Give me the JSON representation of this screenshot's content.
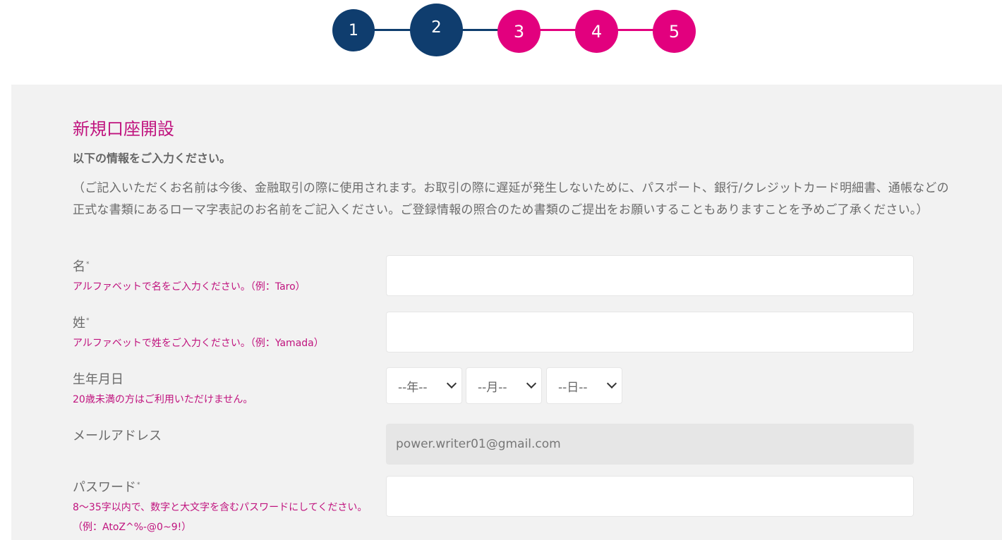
{
  "stepper": {
    "steps": [
      {
        "label": "1",
        "state": "done"
      },
      {
        "label": "2",
        "state": "current"
      },
      {
        "label": "3",
        "state": "todo"
      },
      {
        "label": "4",
        "state": "todo"
      },
      {
        "label": "5",
        "state": "todo"
      }
    ],
    "colors": {
      "done": "#0f3d6e",
      "todo": "#e2007e"
    }
  },
  "form": {
    "title": "新規口座開設",
    "subtitle": "以下の情報をご入力ください。",
    "notice": "（ご記入いただくお名前は今後、金融取引の際に使用されます。お取引の際に遅延が発生しないために、パスポート、銀行/クレジットカード明細書、通帳などの正式な書類にあるローマ字表記のお名前をご記入ください。ご登録情報の照合のため書類のご提出をお願いすることもありますことを予めご了承ください。）",
    "required_mark": "*",
    "first_name": {
      "label": "名",
      "hint": "アルファベットで名をご入力ください。（例：Taro）",
      "value": ""
    },
    "last_name": {
      "label": "姓",
      "hint": "アルファベットで姓をご入力ください。（例：Yamada）",
      "value": ""
    },
    "birthdate": {
      "label": "生年月日",
      "hint": "20歳未満の方はご利用いただけません。",
      "year": "--年--",
      "month": "--月--",
      "day": "--日--"
    },
    "email": {
      "label": "メールアドレス",
      "value": "power.writer01@gmail.com"
    },
    "password": {
      "label": "パスワード",
      "hint": "8〜35字以内で、数字と大文字を含むパスワードにしてください。（例：AtoZ^%-@0~9!）",
      "value": ""
    }
  }
}
